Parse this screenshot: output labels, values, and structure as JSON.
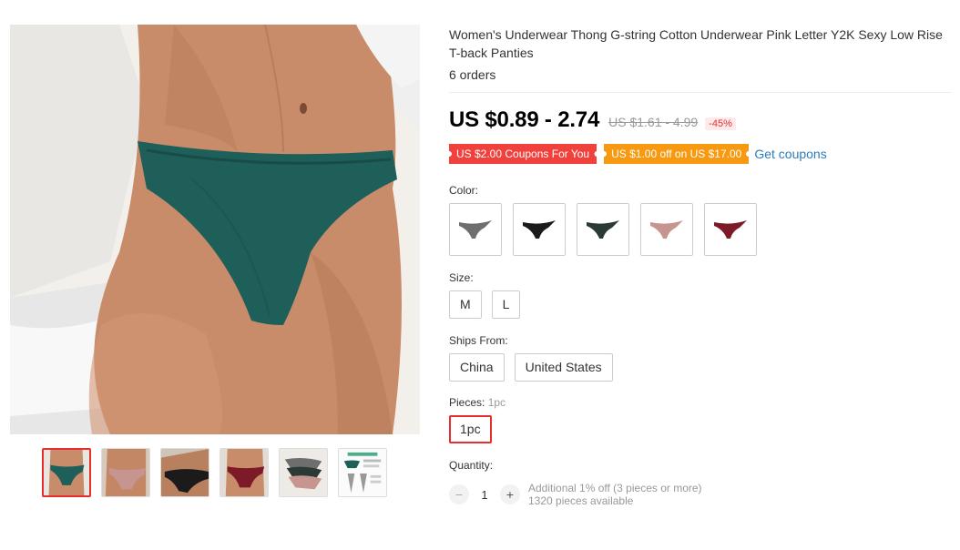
{
  "product": {
    "title": "Women's Underwear Thong G-string Cotton Underwear Pink Letter Y2K Sexy Low Rise T-back Panties",
    "orders": "6 orders"
  },
  "price": {
    "current": "US $0.89 - 2.74",
    "original": "US $1.61 - 4.99",
    "discount": "-45%"
  },
  "coupons": {
    "coupon1": "US $2.00 Coupons For You",
    "coupon2": "US $1.00 off on US $17.00",
    "get_label": "Get coupons",
    "colors": {
      "coupon1": "#f0413d",
      "coupon2": "#f79a12"
    }
  },
  "color": {
    "label": "Color:",
    "swatches": [
      {
        "name": "gray",
        "hex": "#6e6e6e"
      },
      {
        "name": "black",
        "hex": "#1b1b1b"
      },
      {
        "name": "dark-green",
        "hex": "#2c3a36"
      },
      {
        "name": "pink",
        "hex": "#c7958f"
      },
      {
        "name": "wine-red",
        "hex": "#7d1a28"
      }
    ]
  },
  "size": {
    "label": "Size:",
    "options": [
      "M",
      "L"
    ]
  },
  "ships": {
    "label": "Ships From:",
    "options": [
      "China",
      "United States"
    ]
  },
  "pieces": {
    "label": "Pieces:",
    "selected": "1pc",
    "options": [
      "1pc"
    ]
  },
  "quantity": {
    "label": "Quantity:",
    "minus": "−",
    "value": "1",
    "plus": "+",
    "note_line1": "Additional 1% off (3 pieces or more)",
    "note_line2": "1320 pieces available"
  },
  "gallery": {
    "thumb_count": 6,
    "active_index": 0,
    "accent": "#e62e2e"
  }
}
